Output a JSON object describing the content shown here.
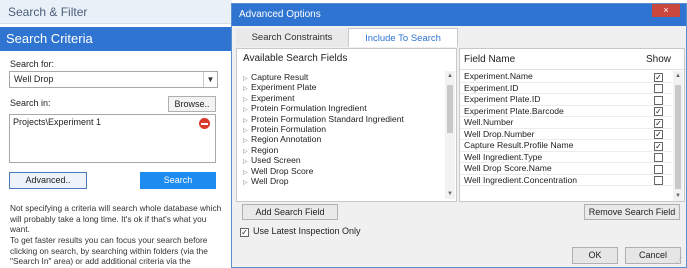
{
  "left_panel": {
    "header": "Search & Filter",
    "section_title": "Search Criteria",
    "search_for_label": "Search for:",
    "search_for_value": "Well Drop",
    "search_in_label": "Search in:",
    "browse_label": "Browse..",
    "search_in_items": [
      "Projects\\Experiment 1"
    ],
    "advanced_label": "Advanced..",
    "search_label": "Search",
    "note1": "Not specifying a criteria will search whole database which will probably take a long time. It's ok if that's what you want.",
    "note2": "To get faster results you can focus your search before clicking on search, by searching within folders (via the \"Search In\" area) or add additional criteria via the \"Advanced\" button."
  },
  "dialog": {
    "title": "Advanced Options",
    "close_label": "×",
    "tabs": [
      {
        "label": "Search Constraints"
      },
      {
        "label": "Include To Search"
      }
    ],
    "active_tab": "Include To Search",
    "available_header": "Available Search Fields",
    "available_fields": [
      "Capture Result",
      "Experiment Plate",
      "Experiment",
      "Protein Formulation Ingredient",
      "Protein Formulation Standard Ingredient",
      "Protein Formulation",
      "Region Annotation",
      "Region",
      "Used Screen",
      "Well Drop Score",
      "Well Drop"
    ],
    "field_name_header": "Field Name",
    "show_header": "Show",
    "fields": [
      {
        "name": "Experiment.Name",
        "show": "✓"
      },
      {
        "name": "Experiment.ID",
        "show": ""
      },
      {
        "name": "Experiment Plate.ID",
        "show": ""
      },
      {
        "name": "Experiment Plate.Barcode",
        "show": "✓"
      },
      {
        "name": "Well.Number",
        "show": "✓"
      },
      {
        "name": "Well Drop.Number",
        "show": "✓"
      },
      {
        "name": "Capture Result.Profile Name",
        "show": "✓"
      },
      {
        "name": "Well Ingredient.Type",
        "show": ""
      },
      {
        "name": "Well Drop Score.Name",
        "show": ""
      },
      {
        "name": "Well Ingredient.Concentration",
        "show": ""
      }
    ],
    "add_field_label": "Add Search Field",
    "remove_field_label": "Remove Search Field",
    "use_latest_label": "Use Latest Inspection Only",
    "use_latest_checked": "✓",
    "ok_label": "OK",
    "cancel_label": "Cancel"
  },
  "colors": {
    "accent": "#2f74d0",
    "search_button": "#1e8bf0",
    "remove_icon": "#d93a2b",
    "close_button": "#c9473d"
  }
}
